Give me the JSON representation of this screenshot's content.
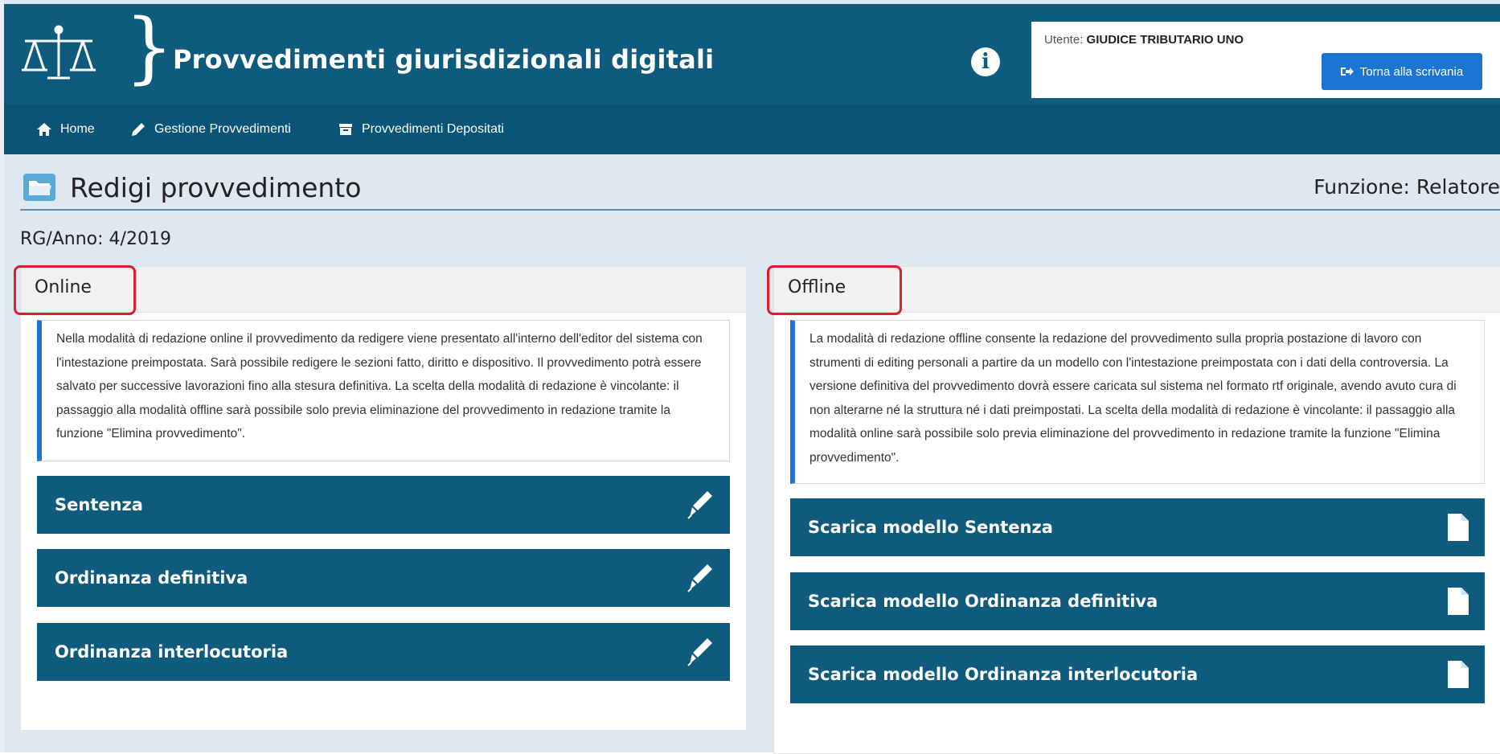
{
  "header": {
    "app_title": "Provvedimenti giurisdizionali digitali",
    "user_prefix": "Utente: ",
    "user_name": "GIUDICE TRIBUTARIO UNO",
    "back_button_label": "Torna alla scrivania"
  },
  "nav": {
    "items": [
      {
        "label": "Home",
        "icon": "home-icon"
      },
      {
        "label": "Gestione Provvedimenti",
        "icon": "pencil-icon"
      },
      {
        "label": "Provvedimenti Depositati",
        "icon": "archive-icon"
      }
    ]
  },
  "page": {
    "title": "Redigi provvedimento",
    "role": "Funzione: Relatore",
    "rg": "RG/Anno: 4/2019"
  },
  "online": {
    "label": "Online",
    "description": "Nella modalità di redazione online il provvedimento da redigere viene presentato all'interno dell'editor del sistema con l'intestazione preimpostata. Sarà possibile redigere le sezioni fatto, diritto e dispositivo. Il provvedimento potrà essere salvato per successive lavorazioni fino alla stesura definitiva. La scelta della modalità di redazione è vincolante: il passaggio alla modalità offline sarà possibile solo previa eliminazione del provvedimento in redazione tramite la funzione \"Elimina provvedimento\".",
    "actions": [
      "Sentenza",
      "Ordinanza definitiva",
      "Ordinanza interlocutoria"
    ]
  },
  "offline": {
    "label": "Offline",
    "description": "La modalità di redazione offline consente la redazione del provvedimento sulla propria postazione di lavoro con strumenti di editing personali a partire da un modello con l'intestazione preimpostata con i dati della controversia. La versione definitiva del provvedimento dovrà essere caricata sul sistema nel formato rtf originale, avendo avuto cura di non alterarne né la struttura né i dati preimpostati. La scelta della modalità di redazione è vincolante: il passaggio alla modalità online sarà possibile solo previa eliminazione del provvedimento in redazione tramite la funzione \"Elimina provvedimento\".",
    "actions": [
      "Scarica modello Sentenza",
      "Scarica modello Ordinanza definitiva",
      "Scarica modello Ordinanza interlocutoria"
    ]
  },
  "colors": {
    "header_bg": "#0e5b7e",
    "primary_button": "#1a76d2",
    "highlight_border": "#dc1e2c"
  }
}
